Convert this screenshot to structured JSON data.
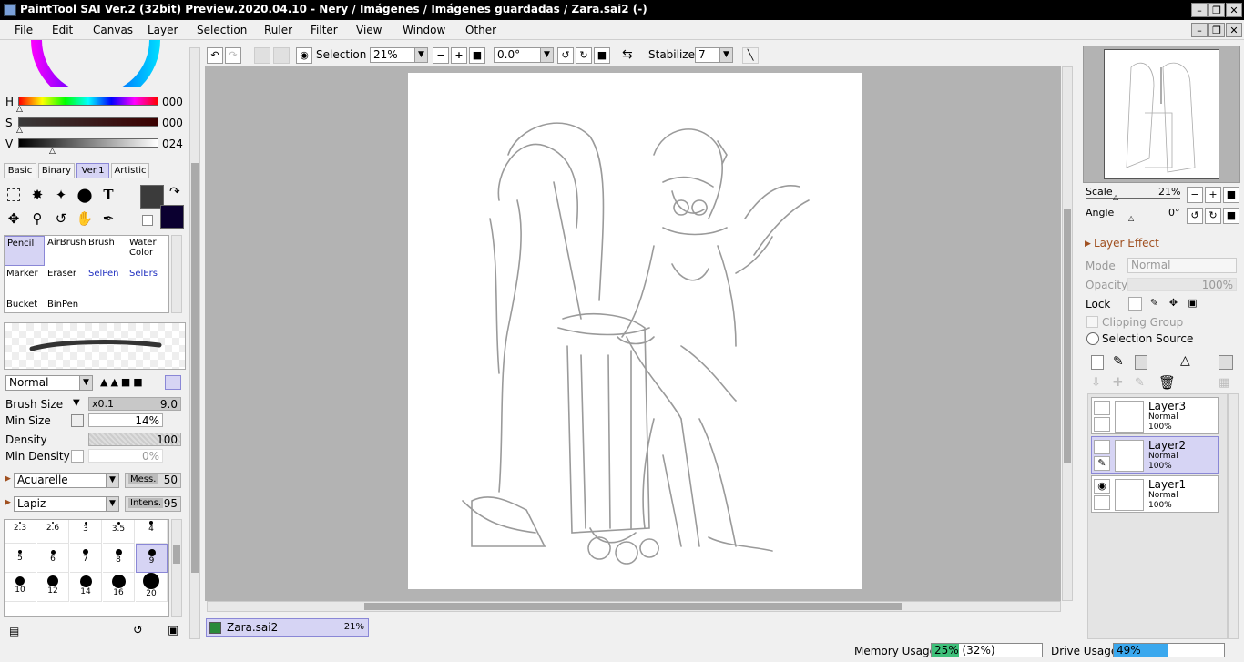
{
  "window": {
    "title": "PaintTool SAI Ver.2 (32bit) Preview.2020.04.10 - Nery / Imágenes / Imágenes guardadas / Zara.sai2 (-)"
  },
  "menu": [
    "File",
    "Edit",
    "Canvas",
    "Layer",
    "Selection",
    "Ruler",
    "Filter",
    "View",
    "Window",
    "Other"
  ],
  "color": {
    "h_label": "H",
    "h_value": "000",
    "s_label": "S",
    "s_value": "000",
    "v_label": "V",
    "v_value": "024",
    "primary": "#3b3b3b",
    "secondary": "#0b0030"
  },
  "color_tabs": [
    "Basic",
    "Binary",
    "Ver.1",
    "Artistic"
  ],
  "brush_tools": [
    [
      "Pencil",
      "AirBrush",
      "Brush",
      "Water Color"
    ],
    [
      "Marker",
      "Eraser",
      "SelPen",
      "SelErs"
    ],
    [
      "Bucket",
      "BinPen",
      "",
      ""
    ]
  ],
  "brush_settings": {
    "mode": "Normal",
    "brush_size_label": "Brush Size",
    "brush_size_mult": "x0.1",
    "brush_size_value": "9.0",
    "min_size_label": "Min Size",
    "min_size_value": "14%",
    "density_label": "Density",
    "density_value": "100",
    "min_density_label": "Min Density",
    "min_density_value": "0%",
    "texture1": "Acuarelle",
    "texture1_param_label": "Mess.",
    "texture1_param_value": "50",
    "texture2": "Lapiz",
    "texture2_param_label": "Intens.",
    "texture2_param_value": "95"
  },
  "dot_sizes": [
    {
      "label": "2.3",
      "d": 2
    },
    {
      "label": "2.6",
      "d": 2
    },
    {
      "label": "3",
      "d": 3
    },
    {
      "label": "3.5",
      "d": 3
    },
    {
      "label": "4",
      "d": 4
    },
    {
      "label": "5",
      "d": 4
    },
    {
      "label": "6",
      "d": 5
    },
    {
      "label": "7",
      "d": 6
    },
    {
      "label": "8",
      "d": 7
    },
    {
      "label": "9",
      "d": 8
    },
    {
      "label": "10",
      "d": 10
    },
    {
      "label": "12",
      "d": 12
    },
    {
      "label": "14",
      "d": 13
    },
    {
      "label": "16",
      "d": 15
    },
    {
      "label": "20",
      "d": 18
    }
  ],
  "toolbar": {
    "selection_label": "Selection",
    "zoom": "21%",
    "angle": "0.0°",
    "stabilizer_label": "Stabilizer",
    "stabilizer_value": "7"
  },
  "navigator": {
    "scale_label": "Scale",
    "scale_value": "21%",
    "angle_label": "Angle",
    "angle_value": "0°"
  },
  "layer_effect": {
    "title": "Layer Effect",
    "mode_label": "Mode",
    "mode_value": "Normal",
    "opacity_label": "Opacity",
    "opacity_value": "100%",
    "lock_label": "Lock",
    "clipping_label": "Clipping Group",
    "selection_source_label": "Selection Source"
  },
  "layers": [
    {
      "name": "Layer3",
      "mode": "Normal",
      "opacity": "100%"
    },
    {
      "name": "Layer2",
      "mode": "Normal",
      "opacity": "100%"
    },
    {
      "name": "Layer1",
      "mode": "Normal",
      "opacity": "100%"
    }
  ],
  "document_tab": {
    "name": "Zara.sai2",
    "zoom": "21%"
  },
  "status": {
    "memory_label": "Memory Usage",
    "memory_value": "25% (32%)",
    "memory_fraction": 0.25,
    "drive_label": "Drive Usage",
    "drive_value": "49%",
    "drive_fraction": 0.49
  }
}
